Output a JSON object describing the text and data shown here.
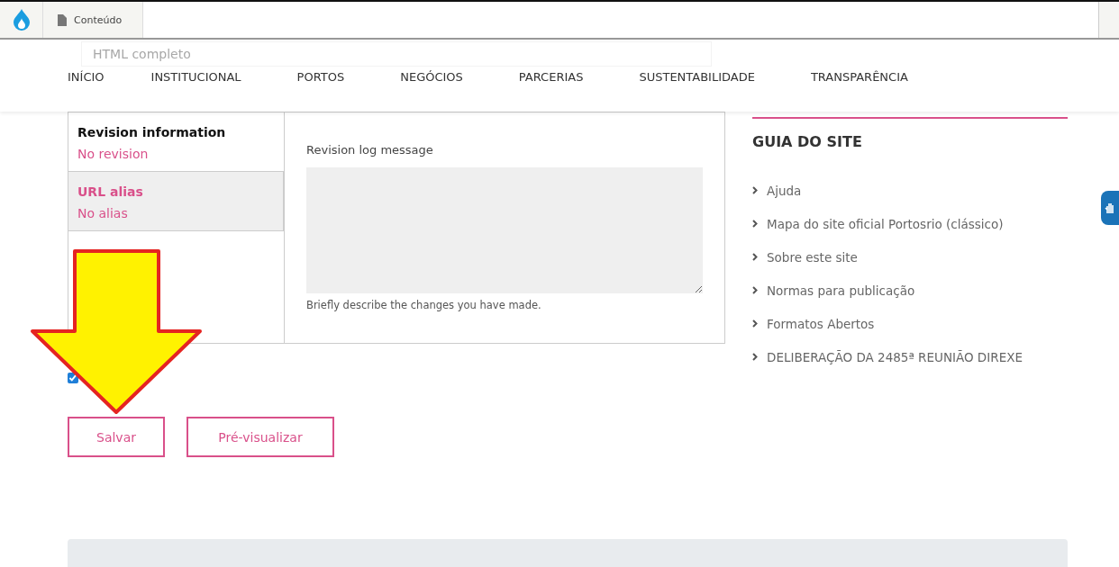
{
  "toolbar": {
    "tab": "Conteúdo"
  },
  "format_select": {
    "value": "HTML completo"
  },
  "nav": [
    {
      "label": "INÍCIO"
    },
    {
      "label": "INSTITUCIONAL"
    },
    {
      "label": "PORTOS"
    },
    {
      "label": "NEGÓCIOS"
    },
    {
      "label": "PARCERIAS"
    },
    {
      "label": "SUSTENTABILIDADE"
    },
    {
      "label": "TRANSPARÊNCIA"
    }
  ],
  "vertical_tabs": [
    {
      "title": "Revision information",
      "summary": "No revision",
      "selected": true
    },
    {
      "title": "URL alias",
      "summary": "No alias",
      "selected": false
    }
  ],
  "revision_pane": {
    "label": "Revision log message",
    "description": "Briefly describe the changes you have made."
  },
  "checkbox": {
    "checked": true
  },
  "buttons": [
    {
      "label": "Salvar"
    },
    {
      "label": "Pré-visualizar"
    }
  ],
  "sidebar": {
    "title": "GUIA DO SITE",
    "links": [
      {
        "label": "Ajuda"
      },
      {
        "label": "Mapa do site oficial Portosrio (clássico)"
      },
      {
        "label": "Sobre este site"
      },
      {
        "label": "Normas para publicação"
      },
      {
        "label": "Formatos Abertos"
      },
      {
        "label": "DELIBERAÇÃO DA 2485ª REUNIÃO DIREXE"
      }
    ]
  }
}
